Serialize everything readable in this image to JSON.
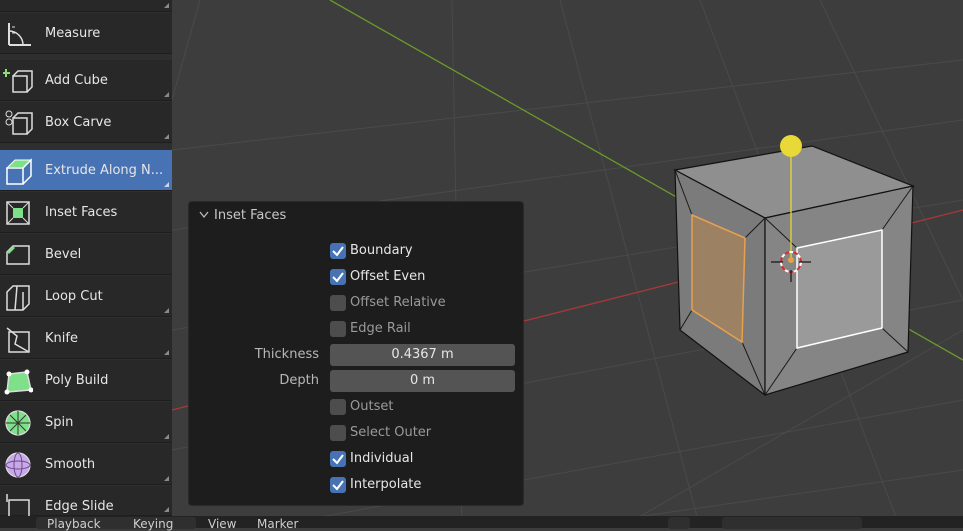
{
  "tools": [
    {
      "label": "Measure",
      "icon": "measure-icon",
      "corner": false,
      "active": false
    },
    {
      "label": "Add Cube",
      "icon": "add-cube-icon",
      "corner": true,
      "active": false
    },
    {
      "label": "Box Carve",
      "icon": "box-carve-icon",
      "corner": true,
      "active": false
    },
    {
      "label": "Extrude Along N...",
      "icon": "extrude-icon",
      "corner": true,
      "active": true
    },
    {
      "label": "Inset Faces",
      "icon": "inset-faces-icon",
      "corner": false,
      "active": false
    },
    {
      "label": "Bevel",
      "icon": "bevel-icon",
      "corner": false,
      "active": false
    },
    {
      "label": "Loop Cut",
      "icon": "loop-cut-icon",
      "corner": true,
      "active": false
    },
    {
      "label": "Knife",
      "icon": "knife-icon",
      "corner": true,
      "active": false
    },
    {
      "label": "Poly Build",
      "icon": "poly-build-icon",
      "corner": false,
      "active": false
    },
    {
      "label": "Spin",
      "icon": "spin-icon",
      "corner": true,
      "active": false
    },
    {
      "label": "Smooth",
      "icon": "smooth-icon",
      "corner": true,
      "active": false
    },
    {
      "label": "Edge Slide",
      "icon": "edge-slide-icon",
      "corner": true,
      "active": false
    }
  ],
  "panel": {
    "title": "Inset Faces",
    "boundary": {
      "label": "Boundary",
      "checked": true
    },
    "offset_even": {
      "label": "Offset Even",
      "checked": true
    },
    "offset_relative": {
      "label": "Offset Relative",
      "checked": false
    },
    "edge_rail": {
      "label": "Edge Rail",
      "checked": false
    },
    "thickness": {
      "label": "Thickness",
      "value": "0.4367 m"
    },
    "depth": {
      "label": "Depth",
      "value": "0 m"
    },
    "outset": {
      "label": "Outset",
      "checked": false
    },
    "select_outer": {
      "label": "Select Outer",
      "checked": false
    },
    "individual": {
      "label": "Individual",
      "checked": true
    },
    "interpolate": {
      "label": "Interpolate",
      "checked": true
    }
  },
  "timeline": {
    "playback": "Playback",
    "keying": "Keying",
    "view": "View",
    "marker": "Marker"
  },
  "colors": {
    "accent": "#4772b3",
    "selected_face": "#e8a050",
    "gizmo": "#e8d838",
    "x_axis": "#b83a3a",
    "y_axis": "#6a9a2a"
  }
}
